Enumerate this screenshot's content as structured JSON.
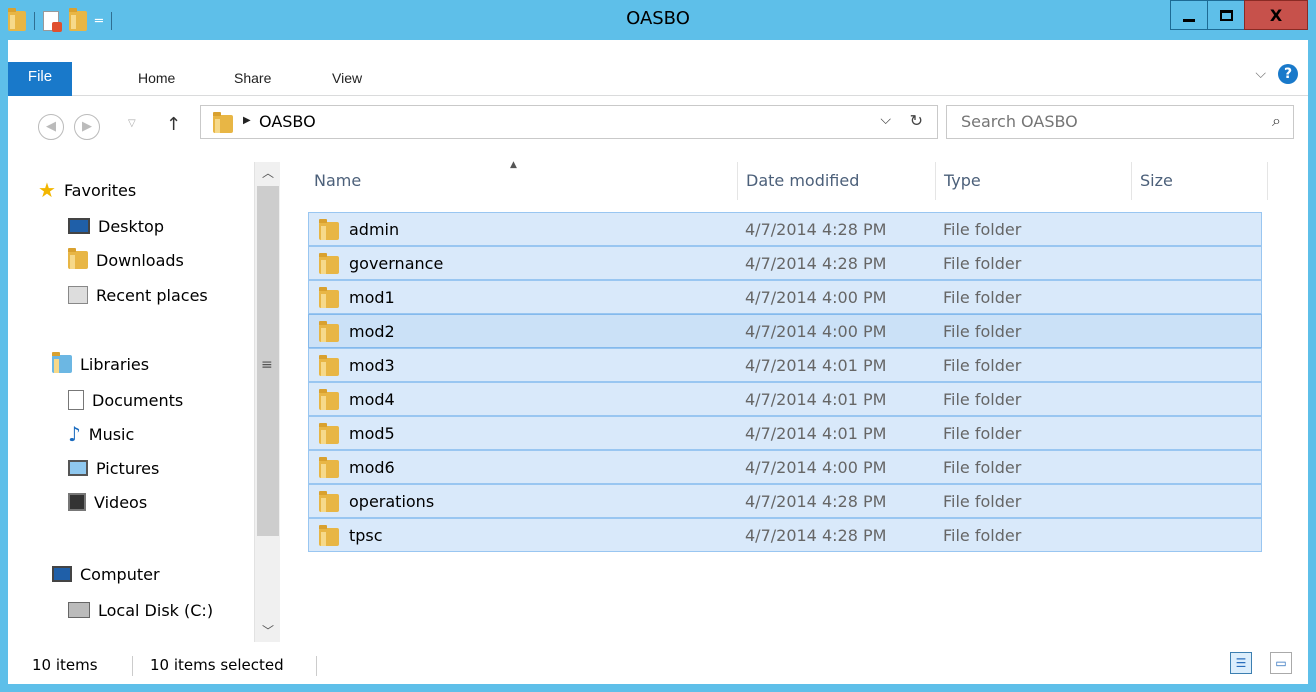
{
  "window": {
    "title": "OASBO",
    "close_glyph": "X"
  },
  "ribbon": {
    "tabs": [
      "File",
      "Home",
      "Share",
      "View"
    ],
    "expand_glyph": "⌵",
    "help_glyph": "?"
  },
  "address": {
    "crumb": "OASBO",
    "search_placeholder": "Search OASBO"
  },
  "nav": {
    "favorites": "Favorites",
    "desktop": "Desktop",
    "downloads": "Downloads",
    "recent": "Recent places",
    "libraries": "Libraries",
    "documents": "Documents",
    "music": "Music",
    "pictures": "Pictures",
    "videos": "Videos",
    "computer": "Computer",
    "local_disk": "Local Disk (C:)"
  },
  "columns": {
    "name": "Name",
    "date": "Date modified",
    "type": "Type",
    "size": "Size"
  },
  "files": [
    {
      "name": "admin",
      "date": "4/7/2014 4:28 PM",
      "type": "File folder"
    },
    {
      "name": "governance",
      "date": "4/7/2014 4:28 PM",
      "type": "File folder"
    },
    {
      "name": "mod1",
      "date": "4/7/2014 4:00 PM",
      "type": "File folder"
    },
    {
      "name": "mod2",
      "date": "4/7/2014 4:00 PM",
      "type": "File folder"
    },
    {
      "name": "mod3",
      "date": "4/7/2014 4:01 PM",
      "type": "File folder"
    },
    {
      "name": "mod4",
      "date": "4/7/2014 4:01 PM",
      "type": "File folder"
    },
    {
      "name": "mod5",
      "date": "4/7/2014 4:01 PM",
      "type": "File folder"
    },
    {
      "name": "mod6",
      "date": "4/7/2014 4:00 PM",
      "type": "File folder"
    },
    {
      "name": "operations",
      "date": "4/7/2014 4:28 PM",
      "type": "File folder"
    },
    {
      "name": "tpsc",
      "date": "4/7/2014 4:28 PM",
      "type": "File folder"
    }
  ],
  "status": {
    "item_count": "10 items",
    "selected": "10 items selected"
  },
  "colors": {
    "titlebar": "#5ebfe9",
    "file_tab": "#1979ca",
    "close_button": "#c7514b",
    "selection": "#d9e9fa",
    "selection_border": "#99c6f1"
  }
}
